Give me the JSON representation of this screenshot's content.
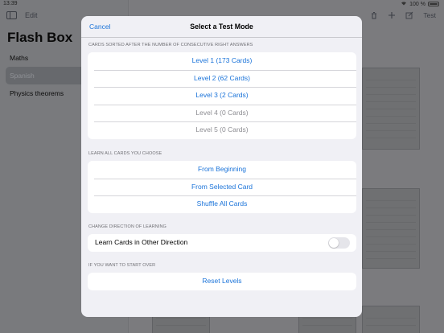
{
  "status": {
    "time": "13:39",
    "battery": "100 %"
  },
  "sidebar": {
    "edit_label": "Edit",
    "title": "Flash Box",
    "items": [
      {
        "label": "Maths"
      },
      {
        "label": "Spanish",
        "selected": true
      },
      {
        "label": "Physics theorems"
      }
    ]
  },
  "toolbar": {
    "test_label": "Test"
  },
  "modal": {
    "cancel_label": "Cancel",
    "title": "Select a Test Mode",
    "sections": {
      "levels": {
        "header": "Cards sorted after the number of consecutive right answers",
        "rows": [
          {
            "label": "Level 1 (173 Cards)",
            "enabled": true
          },
          {
            "label": "Level 2 (62 Cards)",
            "enabled": true
          },
          {
            "label": "Level 3 (2 Cards)",
            "enabled": true
          },
          {
            "label": "Level 4 (0 Cards)",
            "enabled": false
          },
          {
            "label": "Level 5 (0 Cards)",
            "enabled": false
          }
        ]
      },
      "learn_all": {
        "header": "Learn all cards you choose",
        "rows": [
          {
            "label": "From Beginning"
          },
          {
            "label": "From Selected Card"
          },
          {
            "label": "Shuffle All Cards"
          }
        ]
      },
      "direction": {
        "header": "Change direction of learning",
        "toggle_label": "Learn Cards in Other Direction",
        "toggle_on": false
      },
      "reset": {
        "header": "If you want to start over",
        "button_label": "Reset Levels"
      }
    }
  },
  "colors": {
    "accent": "#1a73d9",
    "disabled": "#8e8e93",
    "sheet_bg": "#f0f0f5"
  }
}
